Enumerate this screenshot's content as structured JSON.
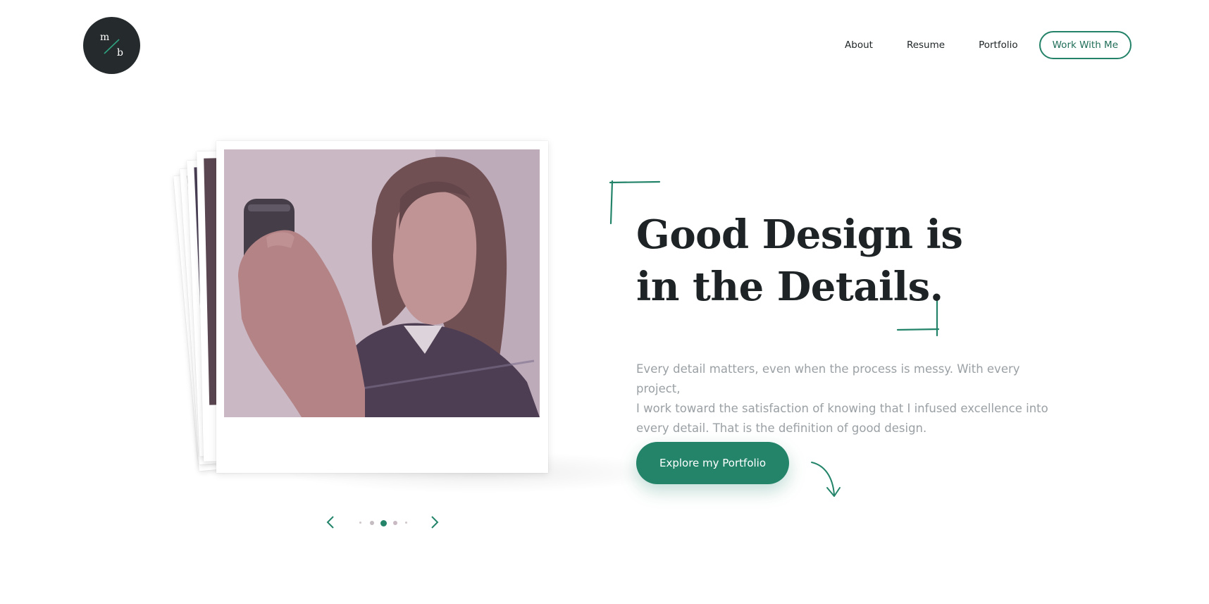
{
  "logo": {
    "top_letter": "m",
    "bottom_letter": "b"
  },
  "nav": {
    "items": [
      "About",
      "Resume",
      "Portfolio"
    ],
    "cta": "Work With Me"
  },
  "hero": {
    "headline_line1": "Good Design is",
    "headline_line2": "in the Details.",
    "description_lines": [
      "Every detail matters, even when the process is messy. With every project,",
      "I work toward the satisfaction of knowing that I infused excellence into",
      "every detail. That is the definition of good design."
    ],
    "button": "Explore my Portfolio"
  },
  "carousel": {
    "active_index": 2,
    "total": 5
  },
  "colors": {
    "accent": "#23846a",
    "dark": "#252b2d",
    "text": "#1e2426",
    "muted": "#9aa0a4"
  },
  "icons": [
    "logo-slash-icon",
    "chevron-left-icon",
    "chevron-right-icon",
    "curved-arrow-icon",
    "corner-bracket-icon"
  ]
}
